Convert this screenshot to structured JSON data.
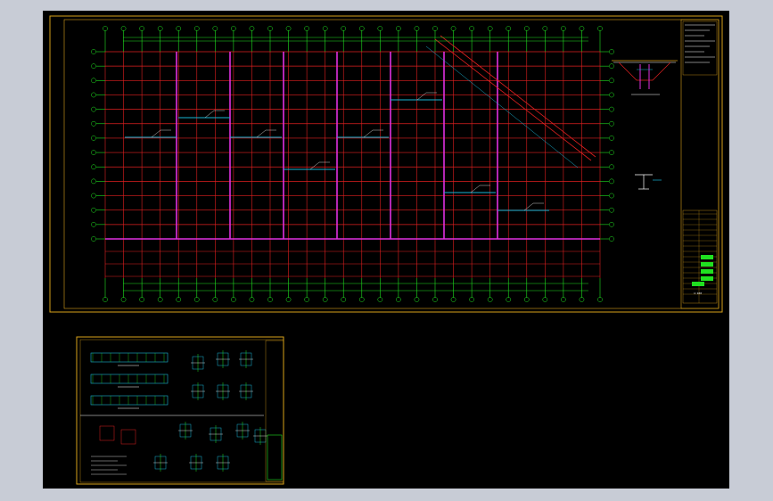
{
  "colors": {
    "background": "#000000",
    "chrome": "#c8ccd6",
    "frame": "#d9a21a",
    "axis": "#20e020",
    "beam": "#e02020",
    "column": "#e030e0",
    "detail": "#19b4d4",
    "text": "#ffffff"
  },
  "grid": {
    "col_count": 28,
    "row_count": 14
  },
  "title_block": {
    "drawing_code": "1:100"
  }
}
